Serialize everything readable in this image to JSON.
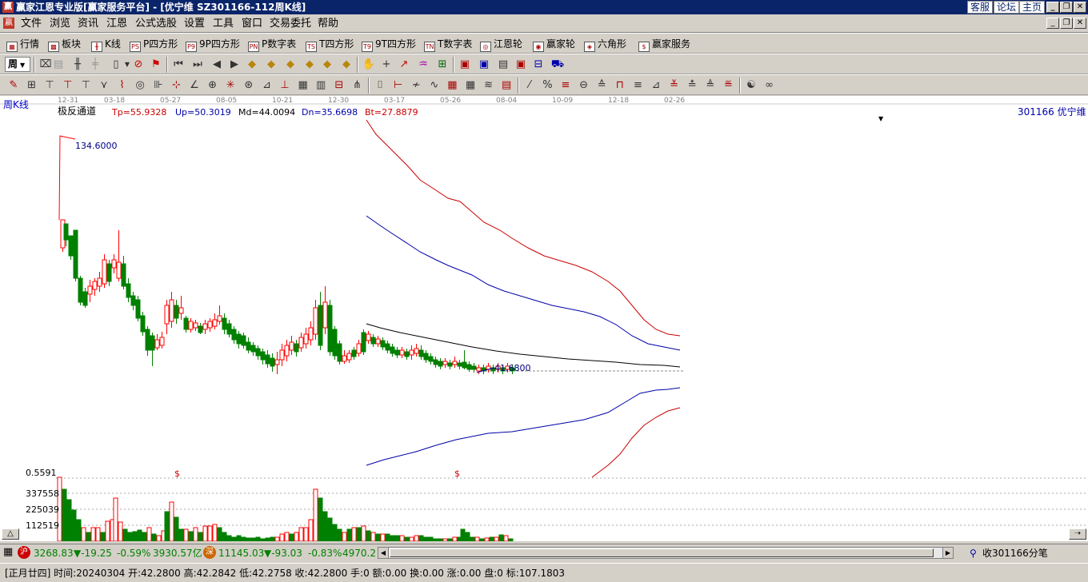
{
  "window": {
    "logo": "赢",
    "title": "赢家江恩专业版[赢家服务平台] - [优宁维  SZ301166-112周K线]",
    "links": [
      "客服",
      "论坛",
      "主页"
    ],
    "controls": [
      "_",
      "❐",
      "✕"
    ]
  },
  "menubar": {
    "logo": "赢",
    "items": [
      "文件",
      "浏览",
      "资讯",
      "江恩",
      "公式选股",
      "设置",
      "工具",
      "窗口",
      "交易委托",
      "帮助"
    ],
    "controls": [
      "_",
      "❐",
      "✕"
    ]
  },
  "toolbar1": {
    "items": [
      {
        "icon": "grid-icon",
        "glyph": "▦",
        "label": "行情"
      },
      {
        "icon": "block-icon",
        "glyph": "▩",
        "label": "板块"
      },
      {
        "icon": "kline-icon",
        "glyph": "╫",
        "label": "K线"
      },
      {
        "icon": "p4-icon",
        "glyph": "PS",
        "label": "P四方形"
      },
      {
        "icon": "9p4-icon",
        "glyph": "P9",
        "label": "9P四方形"
      },
      {
        "icon": "pnum-icon",
        "glyph": "PN",
        "label": "P数字表"
      },
      {
        "icon": "t4-icon",
        "glyph": "TS",
        "label": "T四方形"
      },
      {
        "icon": "9t4-icon",
        "glyph": "T9",
        "label": "9T四方形"
      },
      {
        "icon": "tnum-icon",
        "glyph": "TN",
        "label": "T数字表"
      },
      {
        "icon": "gann-wheel-icon",
        "glyph": "◎",
        "label": "江恩轮"
      },
      {
        "icon": "winner-wheel-icon",
        "glyph": "◉",
        "label": "赢家轮"
      },
      {
        "icon": "hexagon-icon",
        "glyph": "◈",
        "label": "六角形"
      },
      {
        "icon": "dollar-icon",
        "glyph": "$",
        "label": "赢家服务"
      }
    ]
  },
  "toolbar2": {
    "period": "周"
  },
  "chart": {
    "period_label": "周K线",
    "indicator": {
      "name": "极反通道",
      "tp": "Tp=55.9328",
      "up": "Up=50.3019",
      "md": "Md=44.0094",
      "dn": "Dn=35.6698",
      "bt": "Bt=27.8879"
    },
    "stock": "301166 优宁维",
    "high_mark": "134.6000",
    "low_mark": "41.6800",
    "date_ticks": [
      "12-31",
      "03-18",
      "05-27",
      "08-05",
      "10-21",
      "12-30",
      "03-17",
      "05-26",
      "08-04",
      "10-09",
      "12-18",
      "02-26"
    ],
    "volume_scale": [
      "0.5591",
      "337558",
      "225039",
      "112519"
    ],
    "dividend_mark": "$",
    "colors": {
      "up": "#ff0000",
      "down": "#008000",
      "tp_line": "#cc0000",
      "up_line": "#0000aa",
      "md_line": "#000000"
    }
  },
  "status1": {
    "sh_badge": "沪",
    "sh_index": "3268.83",
    "sh_change": "▼-19.25",
    "sh_pct": "-0.59%",
    "sh_amount": "3930.57亿",
    "sz_badge": "深",
    "sz_index": "11145.03",
    "sz_change": "▼-93.03",
    "sz_pct": "-0.83%",
    "sz_amount": "4970.2",
    "trade_label": "收301166分笔"
  },
  "status2": {
    "text": "[正月廿四] 时间:20240304 开:42.2800 高:42.2842 低:42.2758 收:42.2800 手:0 额:0.00 换:0.00 涨:0.00 盘:0 标:107.1803"
  }
}
